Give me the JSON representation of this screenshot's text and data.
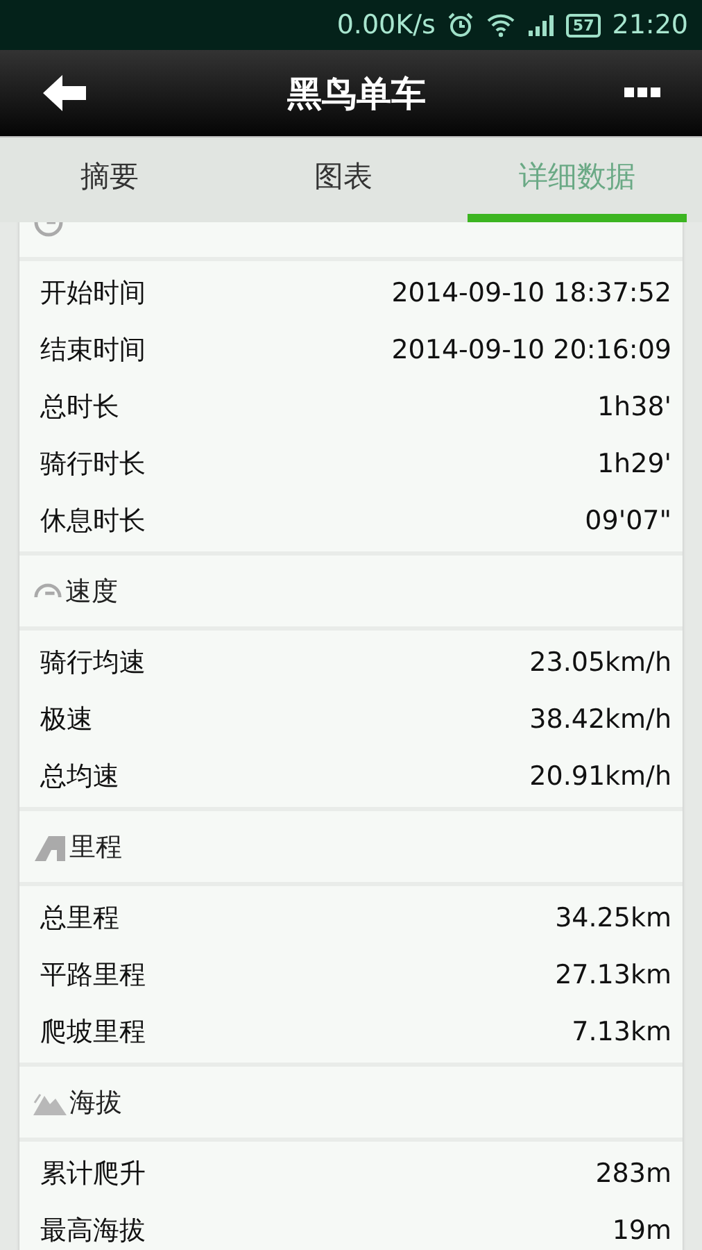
{
  "status_bar": {
    "net_speed": "0.00K/s",
    "battery": "57",
    "time": "21:20"
  },
  "app_bar": {
    "title": "黑鸟单车"
  },
  "tabs": [
    {
      "label": "摘要",
      "selected": false
    },
    {
      "label": "图表",
      "selected": false
    },
    {
      "label": "详细数据",
      "selected": true
    }
  ],
  "sections": [
    {
      "kind": "clock",
      "rows": [
        {
          "label": "开始时间",
          "value": "2014-09-10 18:37:52"
        },
        {
          "label": "结束时间",
          "value": "2014-09-10 20:16:09"
        },
        {
          "label": "总时长",
          "value": "1h38'"
        },
        {
          "label": "骑行时长",
          "value": "1h29'"
        },
        {
          "label": "休息时长",
          "value": "09'07\""
        }
      ]
    },
    {
      "kind": "speed",
      "title": "速度",
      "rows": [
        {
          "label": "骑行均速",
          "value": "23.05km/h"
        },
        {
          "label": "极速",
          "value": "38.42km/h"
        },
        {
          "label": "总均速",
          "value": "20.91km/h"
        }
      ]
    },
    {
      "kind": "road",
      "title": "里程",
      "rows": [
        {
          "label": "总里程",
          "value": "34.25km"
        },
        {
          "label": "平路里程",
          "value": "27.13km"
        },
        {
          "label": "爬坡里程",
          "value": "7.13km"
        }
      ]
    },
    {
      "kind": "mountain",
      "title": "海拔",
      "rows": [
        {
          "label": "累计爬升",
          "value": "283m"
        },
        {
          "label": "最高海拔",
          "value": "19m"
        }
      ]
    }
  ]
}
